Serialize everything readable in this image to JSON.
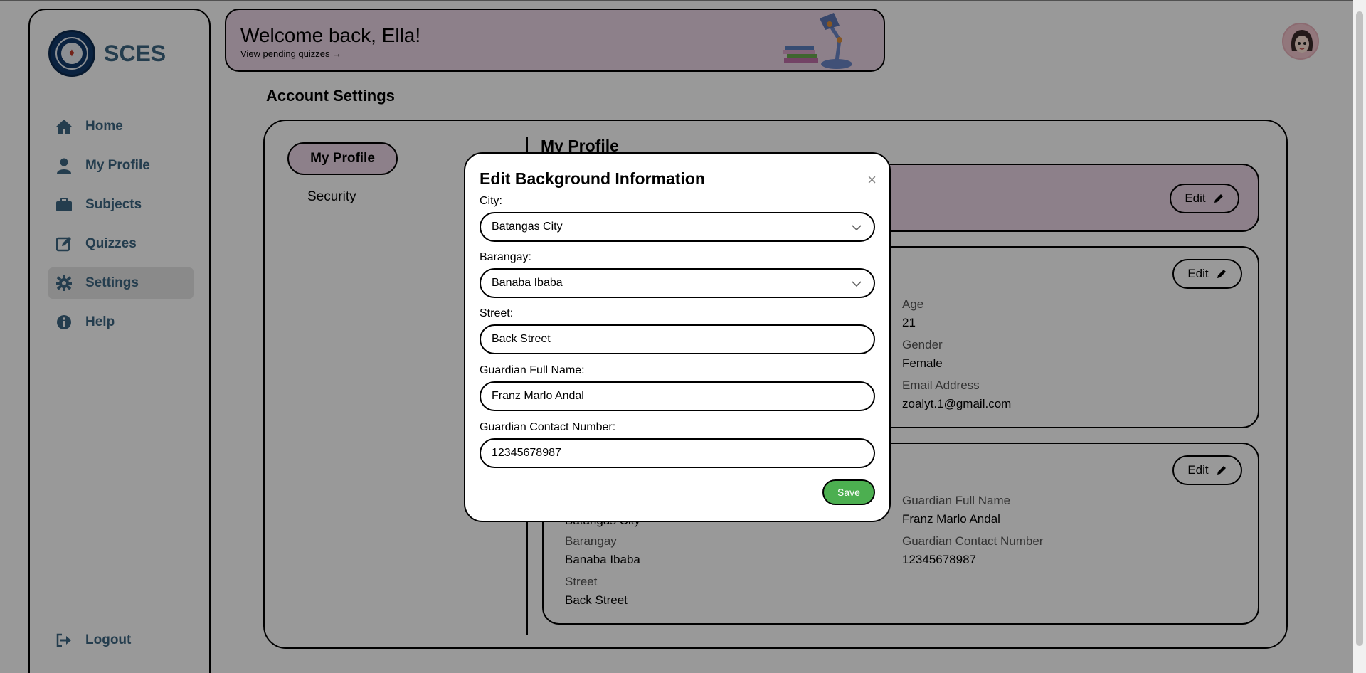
{
  "sidebar": {
    "brand": "SCES",
    "items": [
      {
        "label": "Home",
        "icon": "home-icon"
      },
      {
        "label": "My Profile",
        "icon": "user-icon"
      },
      {
        "label": "Subjects",
        "icon": "briefcase-icon"
      },
      {
        "label": "Quizzes",
        "icon": "edit-icon"
      },
      {
        "label": "Settings",
        "icon": "gear-icon",
        "active": true
      },
      {
        "label": "Help",
        "icon": "info-icon"
      }
    ],
    "logout": "Logout"
  },
  "banner": {
    "welcome": "Welcome back, Ella!",
    "pending_link": "View pending quizzes →"
  },
  "page": {
    "title": "Account Settings",
    "tabs": {
      "my_profile": "My Profile",
      "security": "Security"
    },
    "section_title": "My Profile",
    "edit_label": "Edit",
    "personal": {
      "age_label": "Age",
      "age": "21",
      "gender_label": "Gender",
      "gender": "Female",
      "email_label": "Email Address",
      "email": "zoalyt.1@gmail.com"
    },
    "background": {
      "city": "Batangas City",
      "guardian_name_label": "Guardian Full Name",
      "guardian_name": "Franz Marlo Andal",
      "barangay_label": "Barangay",
      "barangay": "Banaba Ibaba",
      "guardian_contact_label": "Guardian Contact Number",
      "guardian_contact": "12345678987",
      "street_label": "Street",
      "street": "Back Street"
    }
  },
  "modal": {
    "title": "Edit Background Information",
    "close": "×",
    "city_label": "City:",
    "city_value": "Batangas City",
    "barangay_label": "Barangay:",
    "barangay_value": "Banaba Ibaba",
    "street_label": "Street:",
    "street_value": "Back Street",
    "guardian_name_label": "Guardian Full Name:",
    "guardian_name_value": "Franz Marlo Andal",
    "guardian_contact_label": "Guardian Contact Number:",
    "guardian_contact_value": "12345678987",
    "save": "Save"
  },
  "colors": {
    "accent_pink": "#ecd6e6",
    "nav_text": "#3c6682",
    "save_green": "#4caf50"
  }
}
